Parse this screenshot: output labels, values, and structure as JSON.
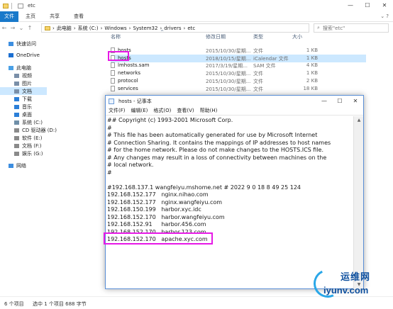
{
  "explorer": {
    "title": "etc",
    "controls": {
      "minimize": "—",
      "maximize": "☐",
      "close": "✕"
    },
    "ribbon": {
      "file": "文件",
      "tabs": [
        "主页",
        "共享",
        "查看"
      ],
      "expand": "⌄ ?"
    },
    "nav": {
      "back": "←",
      "forward": "→",
      "recent": "⌄",
      "up": "↑"
    },
    "address": {
      "parts": [
        "此电脑",
        "系统 (C:)",
        "Windows",
        "System32",
        "drivers",
        "etc"
      ],
      "separator": "›"
    },
    "search_placeholder": "搜索\"etc\"",
    "sidebar": [
      {
        "label": "快速访问",
        "icon": "star-icon",
        "color": "#3d8ee0"
      },
      {
        "label": "OneDrive",
        "icon": "cloud-icon",
        "color": "#1c6fd1"
      },
      {
        "label": "此电脑",
        "icon": "computer-icon",
        "color": "#4aa0e6"
      },
      {
        "label": "视频",
        "icon": "video-icon",
        "color": "#7a8fa8"
      },
      {
        "label": "图片",
        "icon": "picture-icon",
        "color": "#7a8fa8"
      },
      {
        "label": "文档",
        "icon": "document-icon",
        "color": "#7a8fa8"
      },
      {
        "label": "下载",
        "icon": "download-icon",
        "color": "#2b7fd8"
      },
      {
        "label": "音乐",
        "icon": "music-icon",
        "color": "#2b7fd8"
      },
      {
        "label": "桌面",
        "icon": "desktop-icon",
        "color": "#2b7fd8"
      },
      {
        "label": "系统 (C:)",
        "icon": "drive-icon",
        "color": "#6f8fa8"
      },
      {
        "label": "CD 驱动器 (D:)",
        "icon": "cd-drive-icon",
        "color": "#8a8a8a"
      },
      {
        "label": "软件 (E:)",
        "icon": "drive-icon",
        "color": "#8a8a8a"
      },
      {
        "label": "文档 (F:)",
        "icon": "drive-icon",
        "color": "#8a8a8a"
      },
      {
        "label": "娱乐 (G:)",
        "icon": "drive-icon",
        "color": "#8a8a8a"
      },
      {
        "label": "网络",
        "icon": "network-icon",
        "color": "#3d8ee0"
      }
    ],
    "columns": {
      "name": "名称",
      "date": "修改日期",
      "type": "类型",
      "size": "大小",
      "sort_glyph": "^"
    },
    "files": [
      {
        "name": "hosts",
        "date": "2015/10/30/星期...",
        "type": "文件",
        "size": "1 KB",
        "selected": false
      },
      {
        "name": "hosts",
        "date": "2018/10/15/星期...",
        "type": "iCalendar 文件",
        "size": "1 KB",
        "selected": true
      },
      {
        "name": "lmhosts.sam",
        "date": "2017/3/19/星期...",
        "type": "SAM 文件",
        "size": "4 KB",
        "selected": false
      },
      {
        "name": "networks",
        "date": "2015/10/30/星期...",
        "type": "文件",
        "size": "1 KB",
        "selected": false
      },
      {
        "name": "protocol",
        "date": "2015/10/30/星期...",
        "type": "文件",
        "size": "2 KB",
        "selected": false
      },
      {
        "name": "services",
        "date": "2015/10/30/星期...",
        "type": "文件",
        "size": "18 KB",
        "selected": false
      }
    ],
    "status": {
      "count": "6 个项目",
      "selection": "选中 1 个项目  688 字节"
    }
  },
  "notepad": {
    "title": "hosts - 记事本",
    "controls": {
      "minimize": "—",
      "maximize": "☐",
      "close": "✕"
    },
    "menu": [
      "文件(F)",
      "编辑(E)",
      "格式(O)",
      "查看(V)",
      "帮助(H)"
    ],
    "scroll": {
      "up": "▲",
      "down": "▼"
    },
    "lines": [
      "## Copyright (c) 1993-2001 Microsoft Corp.",
      "#",
      "# This file has been automatically generated for use by Microsoft Internet",
      "# Connection Sharing. It contains the mappings of IP addresses to host names",
      "# for the home network. Please do not make changes to the HOSTS.ICS file.",
      "# Any changes may result in a loss of connectivity between machines on the",
      "# local network.",
      "#",
      "",
      "#192.168.137.1 wangfeiyu.mshome.net # 2022 9 0 18 8 49 25 124",
      "192.168.152.177   nginx.nihao.com",
      "192.168.152.177   nginx.wangfeiyu.com",
      "192.168.150.199   harbor.xyc.idc",
      "192.168.152.170   harbor.wangfeiyu.com",
      "192.168.152.91     harbor.456.com",
      "192.168.152.170   harbor.123.com",
      "192.168.152.170   apache.xyc.com"
    ]
  },
  "watermark": {
    "top": "运维网",
    "bottom": "iyunv.com"
  }
}
